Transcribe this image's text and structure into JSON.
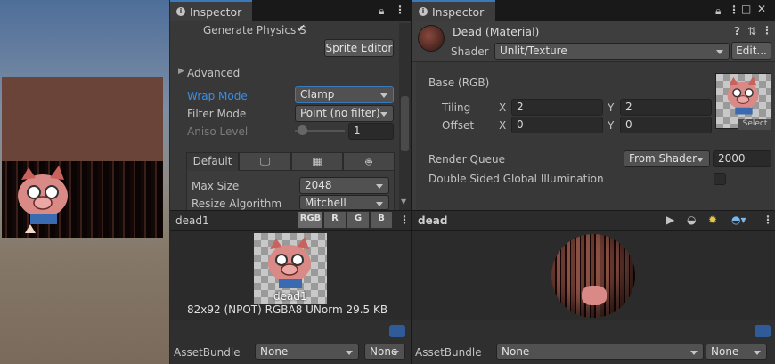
{
  "colors": {
    "accent": "#3a79bb",
    "panel": "#383838",
    "tabbar": "#191919",
    "focus_text": "#3b8ee8"
  },
  "left_inspector": {
    "tab_title": "Inspector",
    "generate_physics_label": "Generate Physics S",
    "sprite_editor_button": "Sprite Editor",
    "advanced_label": "Advanced",
    "wrap_mode_label": "Wrap Mode",
    "wrap_mode_value": "Clamp",
    "filter_mode_label": "Filter Mode",
    "filter_mode_value": "Point (no filter)",
    "aniso_level_label": "Aniso Level",
    "aniso_level_value": "1",
    "platform_tabs": [
      "Default",
      "monitor-icon",
      "grid-icon",
      "android-icon"
    ],
    "platform_default_label": "Default",
    "max_size_label": "Max Size",
    "max_size_value": "2048",
    "resize_algorithm_label": "Resize Algorithm",
    "resize_algorithm_value": "Mitchell",
    "preview": {
      "title": "dead1",
      "channels": [
        "RGB",
        "R",
        "G",
        "B"
      ],
      "caption": "dead1",
      "info": "82x92 (NPOT)  RGBA8 UNorm  29.5 KB"
    },
    "assetbundle_label": "AssetBundle",
    "assetbundle_value": "None",
    "variant_value": "None"
  },
  "right_inspector": {
    "tab_title": "Inspector",
    "material_title": "Dead (Material)",
    "shader_label": "Shader",
    "shader_value": "Unlit/Texture",
    "edit_button": "Edit...",
    "base_label": "Base (RGB)",
    "tiling_label": "Tiling",
    "offset_label": "Offset",
    "x_label": "X",
    "y_label": "Y",
    "tiling_x": "2",
    "tiling_y": "2",
    "offset_x": "0",
    "offset_y": "0",
    "select_button": "Select",
    "render_queue_label": "Render Queue",
    "render_queue_mode": "From Shader",
    "render_queue_value": "2000",
    "double_sided_gi_label": "Double Sided Global Illumination",
    "preview": {
      "title": "dead"
    },
    "assetbundle_label": "AssetBundle",
    "assetbundle_value": "None",
    "variant_value": "None"
  }
}
